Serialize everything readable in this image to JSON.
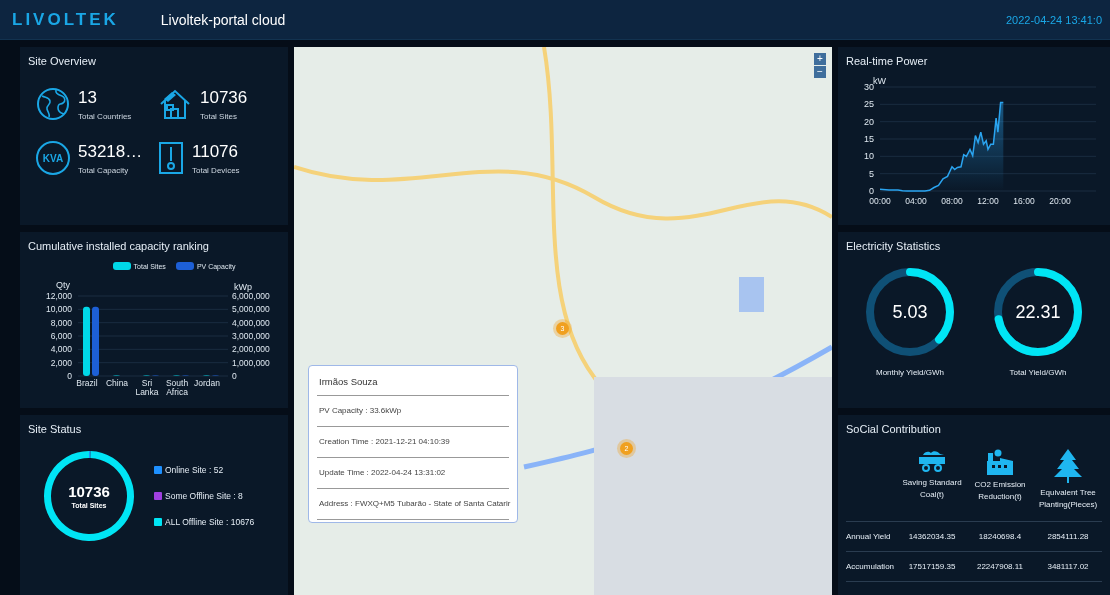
{
  "header": {
    "logo": "LIVOLTEK",
    "title": "Livoltek-portal cloud",
    "datetime": "2022-04-24 13:41:0"
  },
  "site_overview": {
    "title": "Site Overview",
    "stats": [
      {
        "kind": "globe",
        "value": "13",
        "label": "Total Countries"
      },
      {
        "kind": "house",
        "value": "10736",
        "label": "Total Sites"
      },
      {
        "kind": "kva",
        "icon_text": "KVA",
        "value": "53218…",
        "label": "Total Capacity"
      },
      {
        "kind": "device",
        "value": "11076",
        "label": "Total Devices"
      }
    ]
  },
  "capacity_ranking": {
    "title": "Cumulative installed capacity ranking",
    "chart_data": {
      "type": "bar",
      "ylabel": "Qty",
      "y2label": "kWp",
      "categories": [
        "Brazil",
        "China",
        "Sri Lanka",
        "South Africa",
        "Jordan"
      ],
      "series": [
        {
          "name": "Total Sites",
          "color": "#00d8e8",
          "values": [
            10400,
            0,
            0,
            0,
            0
          ]
        },
        {
          "name": "PV Capacity",
          "color": "#1d5fd6",
          "axis": "y2",
          "values": [
            5200000,
            null,
            0,
            0,
            0
          ]
        }
      ],
      "stacked": false,
      "grid": true,
      "ylim": [
        0,
        12000
      ],
      "y2lim": [
        0,
        6000000
      ],
      "yticks": [
        {
          "value": 0,
          "label": "0"
        },
        {
          "value": 2000,
          "label": "2,000"
        },
        {
          "value": 4000,
          "label": "4,000"
        },
        {
          "value": 6000,
          "label": "6,000"
        },
        {
          "value": 8000,
          "label": "8,000"
        },
        {
          "value": 10000,
          "label": "10,000"
        },
        {
          "value": 12000,
          "label": "12,000"
        }
      ],
      "y2ticks": [
        {
          "value": 0,
          "label": "0"
        },
        {
          "value": 1000000,
          "label": "1,000,000"
        },
        {
          "value": 2000000,
          "label": "2,000,000"
        },
        {
          "value": 3000000,
          "label": "3,000,000"
        },
        {
          "value": 4000000,
          "label": "4,000,000"
        },
        {
          "value": 5000000,
          "label": "5,000,000"
        },
        {
          "value": 6000000,
          "label": "6,000,000"
        }
      ]
    }
  },
  "site_status": {
    "title": "Site Status",
    "total": "10736",
    "total_label": "Total Sites",
    "chart_data": {
      "type": "donut",
      "categories": [
        "Online Site : 52",
        "Some Offline Site : 8",
        "ALL Offline Site : 10676"
      ],
      "series": [
        {
          "values": [
            52,
            8,
            10676
          ]
        }
      ],
      "colors": [
        "#1e90ff",
        "#a040e0",
        "#00e5f5"
      ]
    }
  },
  "map": {
    "zoom_in": "+",
    "zoom_out": "−",
    "clusters": [
      {
        "count": "3"
      },
      {
        "count": "2"
      }
    ],
    "popup": {
      "title": "Irmãos Souza",
      "rows": [
        "PV Capacity : 33.6kWp",
        "Creation Time : 2021-12-21 04:10:39",
        "Update Time : 2022-04-24 13:31:02",
        "Address : FWXQ+M5 Tubarão - State of Santa Catarir"
      ]
    }
  },
  "realtime_power": {
    "title": "Real-time Power",
    "chart_data": {
      "type": "area",
      "ylabel": "kW",
      "x": [
        0,
        1,
        2,
        2.5,
        3,
        4,
        5,
        5.5,
        6,
        6.5,
        7,
        7.5,
        8,
        8.3,
        8.6,
        9,
        9.3,
        9.6,
        10,
        10.3,
        10.6,
        10.9,
        11.2,
        11.5,
        11.8,
        12,
        12.3,
        12.6,
        12.9,
        13.1,
        13.4,
        13.7
      ],
      "series": [
        {
          "color": "#2aa4f0",
          "values": [
            0.5,
            0.3,
            0.3,
            0.1,
            0,
            0,
            0,
            0.2,
            1,
            1.6,
            3.5,
            4.2,
            7,
            6.2,
            6.8,
            7,
            10.5,
            10,
            12,
            10.2,
            16,
            14,
            17,
            13.5,
            14.5,
            12,
            13.5,
            13.5,
            21,
            17,
            25.5,
            25.5
          ]
        }
      ],
      "xlim": [
        0,
        24
      ],
      "xticks": [
        {
          "value": 0,
          "label": "00:00"
        },
        {
          "value": 4,
          "label": "04:00"
        },
        {
          "value": 8,
          "label": "08:00"
        },
        {
          "value": 12,
          "label": "12:00"
        },
        {
          "value": 16,
          "label": "16:00"
        },
        {
          "value": 20,
          "label": "20:00"
        }
      ],
      "ylim": [
        0,
        30
      ],
      "grid": true,
      "yticks": [
        {
          "value": 0,
          "label": "0"
        },
        {
          "value": 5,
          "label": "5"
        },
        {
          "value": 10,
          "label": "10"
        },
        {
          "value": 15,
          "label": "15"
        },
        {
          "value": 20,
          "label": "20"
        },
        {
          "value": 25,
          "label": "25"
        },
        {
          "value": 30,
          "label": "30"
        }
      ]
    }
  },
  "electricity_statistics": {
    "title": "Electricity Statistics",
    "gauges": [
      {
        "value": "5.03",
        "label": "Monthly Yield/GWh",
        "level": 0.37
      },
      {
        "value": "22.31",
        "label": "Total Yield/GWh",
        "level": 0.72
      }
    ]
  },
  "social_contribution": {
    "title": "SoCial Contribution",
    "columns": [
      {
        "kind": "coal",
        "label": "Saving Standard Coal(t)"
      },
      {
        "kind": "factory",
        "label": "CO2 Emission Reduction(t)"
      },
      {
        "kind": "tree",
        "label": "Equivalent Tree Planting(Pieces)"
      }
    ],
    "rows": [
      {
        "label": "Annual Yield",
        "values": [
          "14362034.35",
          "18240698.4",
          "2854111.28"
        ]
      },
      {
        "label": "Accumulation",
        "values": [
          "17517159.35",
          "22247908.11",
          "3481117.02"
        ]
      }
    ]
  }
}
